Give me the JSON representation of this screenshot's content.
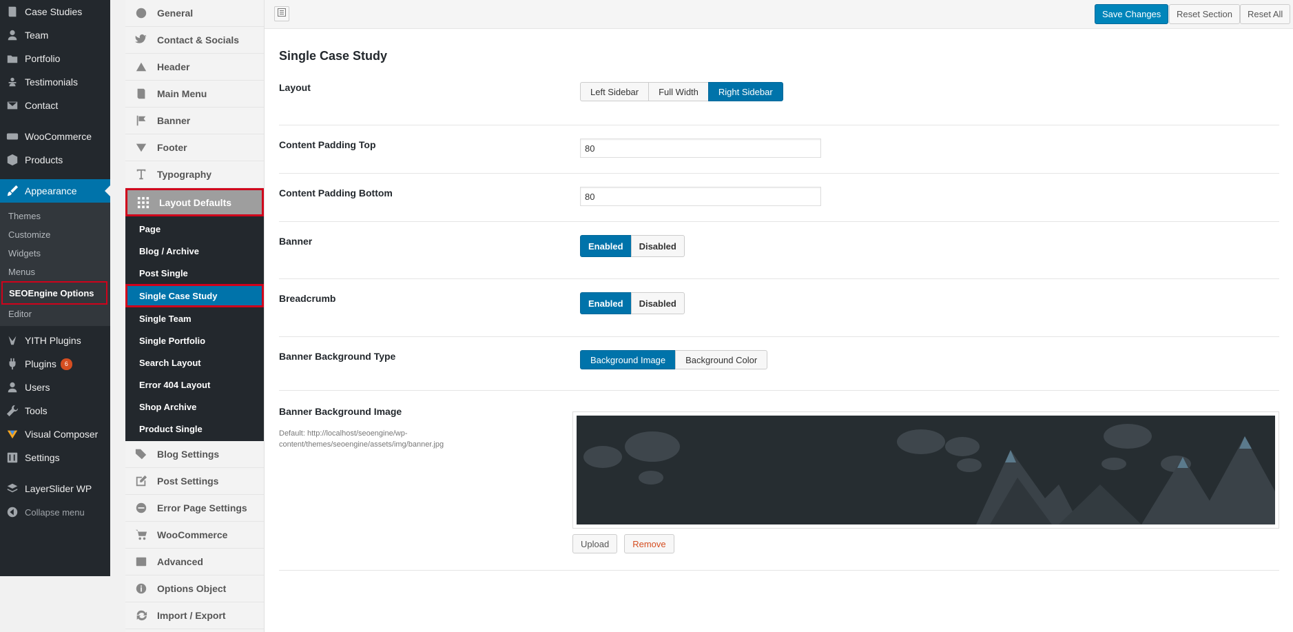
{
  "wp_menu": {
    "items": [
      {
        "label": "Case Studies",
        "icon": "book-icon"
      },
      {
        "label": "Team",
        "icon": "person-icon"
      },
      {
        "label": "Portfolio",
        "icon": "folder-icon"
      },
      {
        "label": "Testimonials",
        "icon": "testimonial-icon"
      },
      {
        "label": "Contact",
        "icon": "mail-icon"
      }
    ],
    "woocommerce": "WooCommerce",
    "products": "Products",
    "appearance": "Appearance",
    "appearance_sub": [
      "Themes",
      "Customize",
      "Widgets",
      "Menus",
      "SEOEngine Options",
      "Editor"
    ],
    "yith": "YITH Plugins",
    "plugins": "Plugins",
    "plugins_badge": "6",
    "users": "Users",
    "tools": "Tools",
    "visual_composer": "Visual Composer",
    "settings": "Settings",
    "layerslider": "LayerSlider WP",
    "collapse": "Collapse menu"
  },
  "options_nav": {
    "items_top": [
      "General",
      "Contact & Socials",
      "Header",
      "Main Menu",
      "Banner",
      "Footer",
      "Typography"
    ],
    "selected": "Layout Defaults",
    "sub": [
      "Page",
      "Blog / Archive",
      "Post Single",
      "Single Case Study",
      "Single Team",
      "Single Portfolio",
      "Search Layout",
      "Error 404 Layout",
      "Shop Archive",
      "Product Single"
    ],
    "items_bottom": [
      "Blog Settings",
      "Post Settings",
      "Error Page Settings",
      "WooCommerce",
      "Advanced",
      "Options Object",
      "Import / Export"
    ]
  },
  "toolbar": {
    "save": "Save Changes",
    "reset_section": "Reset Section",
    "reset_all": "Reset All"
  },
  "section": {
    "title": "Single Case Study",
    "layout": {
      "label": "Layout",
      "options": [
        "Left Sidebar",
        "Full Width",
        "Right Sidebar"
      ],
      "selected": "Right Sidebar"
    },
    "padding_top": {
      "label": "Content Padding Top",
      "value": "80"
    },
    "padding_bottom": {
      "label": "Content Padding Bottom",
      "value": "80"
    },
    "banner": {
      "label": "Banner",
      "options": [
        "Enabled",
        "Disabled"
      ],
      "selected": "Enabled"
    },
    "breadcrumb": {
      "label": "Breadcrumb",
      "options": [
        "Enabled",
        "Disabled"
      ],
      "selected": "Enabled"
    },
    "banner_bg_type": {
      "label": "Banner Background Type",
      "options": [
        "Background Image",
        "Background Color"
      ],
      "selected": "Background Image"
    },
    "banner_bg_image": {
      "label": "Banner Background Image",
      "desc": "Default: http://localhost/seoengine/wp-content/themes/seoengine/assets/img/banner.jpg",
      "upload": "Upload",
      "remove": "Remove"
    }
  },
  "colors": {
    "accent": "#0073aa",
    "highlight_box": "#d0021b",
    "admin_bg": "#23282d"
  }
}
